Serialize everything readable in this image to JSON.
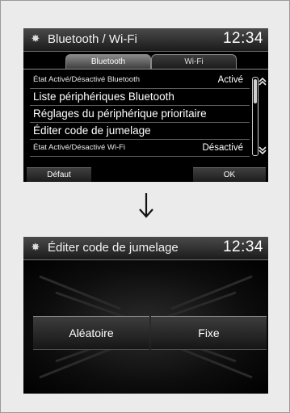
{
  "screen1": {
    "title": "Bluetooth / Wi-Fi",
    "clock": "12:34",
    "tabs": [
      {
        "label": "Bluetooth",
        "active": true
      },
      {
        "label": "Wi-Fi",
        "active": false
      }
    ],
    "rows": [
      {
        "label": "État Activé/Désactivé Bluetooth",
        "value": "Activé"
      },
      {
        "label": "Liste périphériques Bluetooth",
        "value": ""
      },
      {
        "label": "Réglages du périphérique prioritaire",
        "value": ""
      },
      {
        "label": "Éditer code de jumelage",
        "value": ""
      },
      {
        "label": "État Activé/Désactivé Wi-Fi",
        "value": "Désactivé"
      }
    ],
    "buttons": {
      "default": "Défaut",
      "ok": "OK"
    }
  },
  "screen2": {
    "title": "Éditer code de jumelage",
    "clock": "12:34",
    "buttons": {
      "random": "Aléatoire",
      "fixed": "Fixe"
    }
  },
  "icons": {
    "title_icon": "gear-icon",
    "arrow_up": "double-chevron-up-icon",
    "arrow_down": "double-chevron-down-icon",
    "transition": "down-arrow-icon"
  }
}
